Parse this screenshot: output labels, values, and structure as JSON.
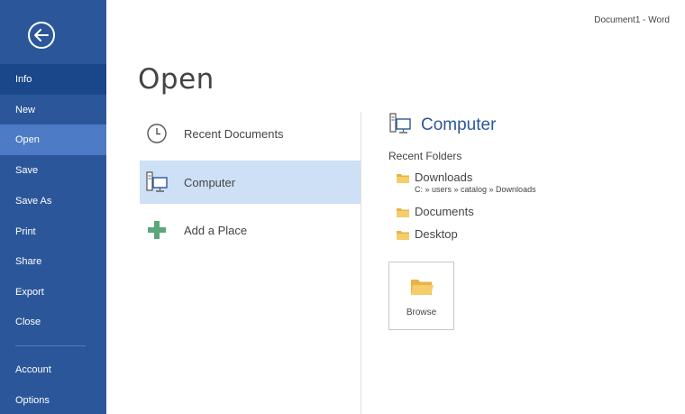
{
  "window": {
    "title": "Document1 - Word"
  },
  "page": {
    "title": "Open"
  },
  "sidebar": {
    "items": [
      {
        "label": "Info"
      },
      {
        "label": "New"
      },
      {
        "label": "Open"
      },
      {
        "label": "Save"
      },
      {
        "label": "Save As"
      },
      {
        "label": "Print"
      },
      {
        "label": "Share"
      },
      {
        "label": "Export"
      },
      {
        "label": "Close"
      },
      {
        "label": "Account"
      },
      {
        "label": "Options"
      }
    ],
    "active": "Open"
  },
  "locations": {
    "items": [
      {
        "label": "Recent Documents",
        "icon": "clock-icon"
      },
      {
        "label": "Computer",
        "icon": "computer-icon"
      },
      {
        "label": "Add a Place",
        "icon": "plus-icon"
      }
    ],
    "selected": "Computer"
  },
  "pane": {
    "title": "Computer",
    "recent_folders_label": "Recent Folders",
    "folders": [
      {
        "name": "Downloads",
        "path": "C: » users » catalog » Downloads"
      },
      {
        "name": "Documents"
      },
      {
        "name": "Desktop"
      }
    ],
    "browse_label": "Browse"
  },
  "colors": {
    "sidebar": "#2b579a",
    "sidebar_active": "#4d7bc5",
    "selected_location": "#cde0f5",
    "accent_text": "#2b579a",
    "folder": "#f2c45a",
    "plus": "#5aa77b"
  }
}
